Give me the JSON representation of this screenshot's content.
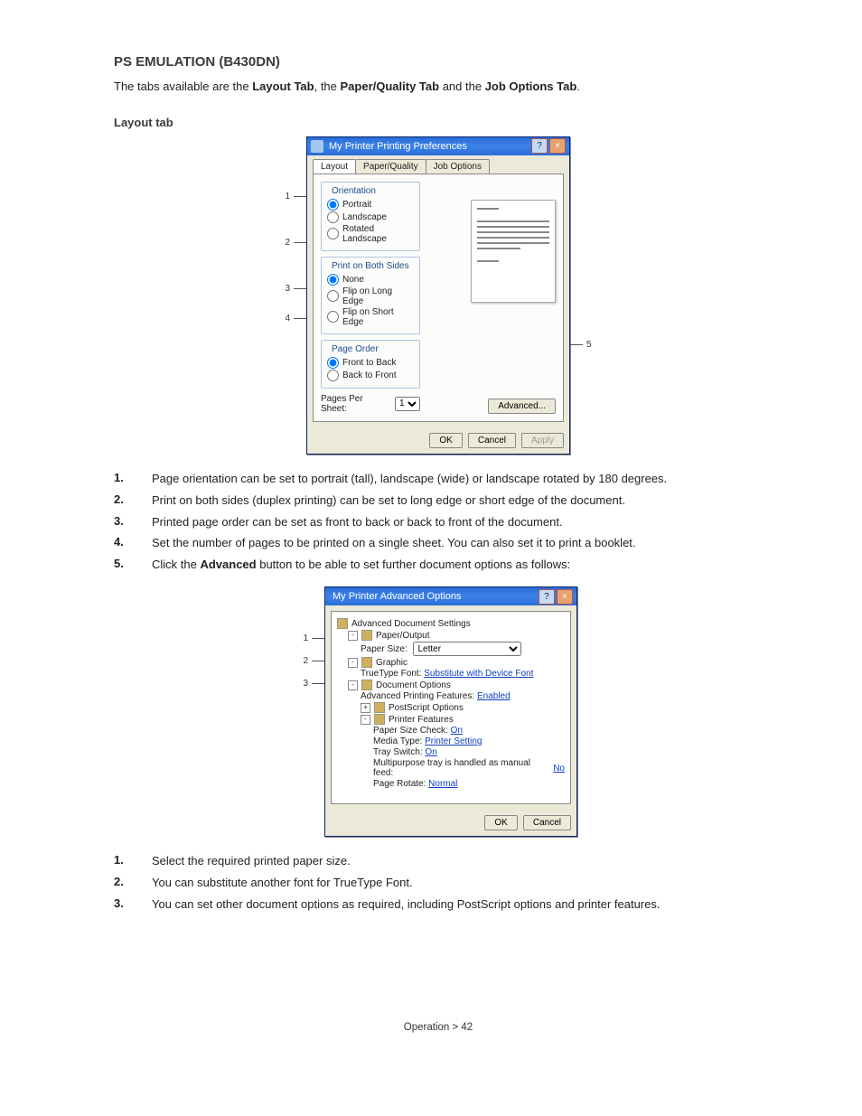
{
  "page": {
    "section_title": "PS EMULATION (B430DN)",
    "intro_pre": "The tabs available are the ",
    "intro_b1": "Layout Tab",
    "intro_mid1": ", the ",
    "intro_b2": "Paper/Quality Tab",
    "intro_mid2": " and the ",
    "intro_b3": "Job Options Tab",
    "intro_post": ".",
    "subtitle1": "Layout tab",
    "footer": "Operation > 42"
  },
  "callouts1": {
    "c1": "1",
    "c2": "2",
    "c3": "3",
    "c4": "4",
    "c5": "5"
  },
  "dialog1": {
    "title": "My Printer Printing Preferences",
    "help": "?",
    "close": "×",
    "tabs": {
      "layout": "Layout",
      "pq": "Paper/Quality",
      "job": "Job Options"
    },
    "orientation": {
      "legend": "Orientation",
      "portrait": "Portrait",
      "landscape": "Landscape",
      "rotated": "Rotated Landscape"
    },
    "duplex": {
      "legend": "Print on Both Sides",
      "none": "None",
      "long": "Flip on Long Edge",
      "short": "Flip on Short Edge"
    },
    "order": {
      "legend": "Page Order",
      "ftb": "Front to Back",
      "btf": "Back to Front"
    },
    "pps": {
      "label": "Pages Per Sheet:",
      "value": "1"
    },
    "advanced": "Advanced...",
    "ok": "OK",
    "cancel": "Cancel",
    "apply": "Apply"
  },
  "list1": {
    "n1": "1.",
    "t1": "Page orientation can be set to portrait (tall), landscape (wide) or landscape rotated by 180 degrees.",
    "n2": "2.",
    "t2": "Print on both sides (duplex printing) can be set to long edge or short edge of the document.",
    "n3": "3.",
    "t3": "Printed page order can be set as front to back or back to front of the document.",
    "n4": "4.",
    "t4": "Set the number of pages to be printed on a single sheet. You can also set it to print a booklet.",
    "n5": "5.",
    "t5_pre": "Click the ",
    "t5_b": "Advanced",
    "t5_post": " button to be able to set further document options as follows:"
  },
  "callouts2": {
    "c1": "1",
    "c2": "2",
    "c3": "3"
  },
  "dialog2": {
    "title": "My Printer Advanced Options",
    "help": "?",
    "close": "×",
    "root": "Advanced Document Settings",
    "paperout": "Paper/Output",
    "papersize_lbl": "Paper Size:",
    "papersize_val": "Letter",
    "graphic": "Graphic",
    "tt_lbl": "TrueType Font:",
    "tt_val": "Substitute with Device Font",
    "docopt": "Document Options",
    "apf_lbl": "Advanced Printing Features:",
    "apf_val": "Enabled",
    "psopt": "PostScript Options",
    "prfeat": "Printer Features",
    "psc_lbl": "Paper Size Check:",
    "psc_val": "On",
    "mt_lbl": "Media Type:",
    "mt_val": "Printer Setting",
    "ts_lbl": "Tray Switch:",
    "ts_val": "On",
    "mpt_lbl": "Multipurpose tray is handled as manual feed:",
    "mpt_val": "No",
    "pr_lbl": "Page Rotate:",
    "pr_val": "Normal",
    "ok": "OK",
    "cancel": "Cancel"
  },
  "list2": {
    "n1": "1.",
    "t1": "Select the required printed paper size.",
    "n2": "2.",
    "t2": "You can substitute another font for TrueType Font.",
    "n3": "3.",
    "t3": "You can set other document options as required, including PostScript options and printer features."
  }
}
